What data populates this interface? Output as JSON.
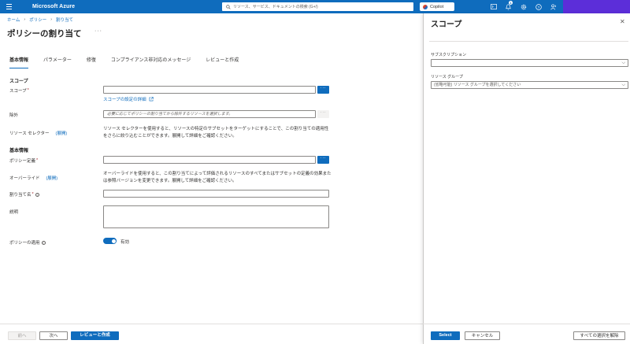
{
  "topbar": {
    "brand": "Microsoft Azure",
    "search_placeholder": "リソース、サービス、ドキュメントの検索 (G+/)",
    "copilot_label": "Copilot",
    "notification_count": "1",
    "icons": [
      "menu-icon",
      "search-icon",
      "terminal-icon",
      "bell-icon",
      "gear-icon",
      "help-icon",
      "feedback-icon"
    ],
    "accent": "#0f6cbd",
    "account_color": "#5c2ed9"
  },
  "breadcrumb": [
    "ホーム",
    "ポリシー",
    "割り当て"
  ],
  "page_title": "ポリシーの割り当て",
  "tabs": [
    {
      "label": "基本情報",
      "active": true
    },
    {
      "label": "パラメーター",
      "active": false
    },
    {
      "label": "修復",
      "active": false
    },
    {
      "label": "コンプライアンス非対応のメッセージ",
      "active": false
    },
    {
      "label": "レビューと作成",
      "active": false
    }
  ],
  "form": {
    "scope_section": "スコープ",
    "scope_label": "スコープ",
    "scope_value": "",
    "scope_link": "スコープの設定の詳細",
    "exclusions_label": "除外",
    "exclusions_placeholder": "必要に応じてポリシーの割り当てから除外するリソースを選択します。",
    "resource_selector_label": "リソース セレクター",
    "resource_selector_expand": "(展開)",
    "resource_selector_help": "リソース セレクターを使用すると、リソースの特定のサブセットをターゲットにすることで、この割り当ての適用性をさらに絞り込むことができます。展開して詳細をご確認ください。",
    "basics_section": "基本情報",
    "policy_definition_label": "ポリシー定義",
    "policy_definition_value": "",
    "overrides_label": "オーバーライド",
    "overrides_expand": "(展開)",
    "overrides_help": "オーバーライドを使用すると、この割り当てによって評価されるリソースのすべてまたはサブセットの定義の効果または参照バージョンを変更できます。展開して詳細をご確認ください。",
    "assignment_name_label": "割り当て名",
    "assignment_name_value": "",
    "description_label": "説明",
    "description_value": "",
    "enforcement_label": "ポリシーの適用",
    "enforcement_state": "有効",
    "enforcement_on": true,
    "browse_button": "···"
  },
  "footer": {
    "previous": "前へ",
    "next": "次へ",
    "review_create": "レビューと作成"
  },
  "scope_panel": {
    "title": "スコープ",
    "subscription_label": "サブスクリプション",
    "subscription_value": "",
    "resource_group_label": "リソース グループ",
    "resource_group_placeholder": "(省略可能) リソース グループを選択してください",
    "select_button": "Select",
    "cancel_button": "キャンセル",
    "clear_button": "すべての選択を解除"
  }
}
